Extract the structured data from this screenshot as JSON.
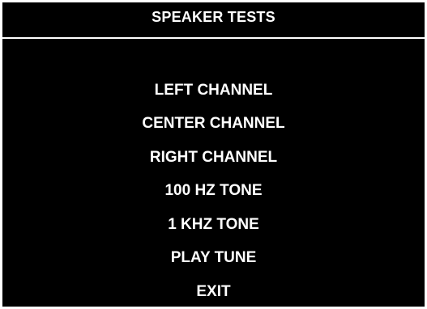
{
  "header": {
    "title": "SPEAKER TESTS"
  },
  "menu": {
    "items": [
      {
        "label": "LEFT CHANNEL"
      },
      {
        "label": "CENTER CHANNEL"
      },
      {
        "label": "RIGHT CHANNEL"
      },
      {
        "label": "100 HZ TONE"
      },
      {
        "label": "1 KHZ TONE"
      },
      {
        "label": "PLAY TUNE"
      },
      {
        "label": "EXIT"
      }
    ]
  },
  "colors": {
    "background": "#000000",
    "text": "#ffffff",
    "border": "#ffffff"
  }
}
